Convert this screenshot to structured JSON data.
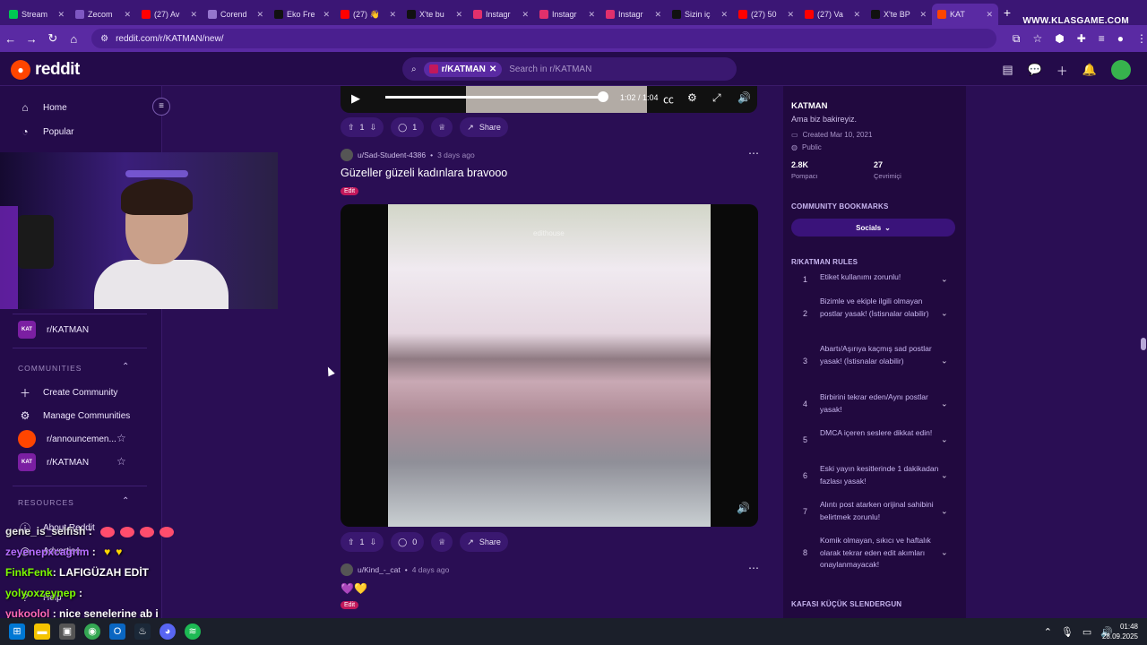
{
  "browser": {
    "tabs": [
      {
        "label": "Stream",
        "color": "#00c853"
      },
      {
        "label": "Zecom",
        "color": "#7e57c2"
      },
      {
        "label": "(27) Av",
        "color": "#ff0000"
      },
      {
        "label": "Corend",
        "color": "#9575cd"
      },
      {
        "label": "Eko Fre",
        "color": "#111111"
      },
      {
        "label": "(27) 👋",
        "color": "#ff0000"
      },
      {
        "label": "X'te bu",
        "color": "#111111"
      },
      {
        "label": "Instagr",
        "color": "#e1306c"
      },
      {
        "label": "Instagr",
        "color": "#e1306c"
      },
      {
        "label": "Instagr",
        "color": "#e1306c"
      },
      {
        "label": "Sizin iç",
        "color": "#111111"
      },
      {
        "label": "(27) 50",
        "color": "#ff0000"
      },
      {
        "label": "(27) Va",
        "color": "#ff0000"
      },
      {
        "label": "X'te BP",
        "color": "#111111"
      },
      {
        "label": "KAT",
        "color": "#ff4500"
      }
    ],
    "url": "reddit.com/r/KATMAN/new/",
    "watermark": "WWW.KLASGAME.COM"
  },
  "header": {
    "logo_text": "reddit",
    "search_chip": "r/KATMAN",
    "search_placeholder": "Search in r/KATMAN"
  },
  "left_nav": {
    "home": "Home",
    "popular": "Popular",
    "sub_katman": "r/KATMAN",
    "communities_label": "COMMUNITIES",
    "create_community": "Create Community",
    "manage_communities": "Manage Communities",
    "announcements": "r/announcemen...",
    "katman": "r/KATMAN",
    "resources_label": "RESOURCES",
    "about": "About Reddit",
    "advertise": "Advertise",
    "help": "Help"
  },
  "chat": [
    {
      "user": "gene_is_selfish",
      "text": ":"
    },
    {
      "user": "zeyenepxcagrim",
      "text": ":"
    },
    {
      "user": "FinkFenk",
      "text": ": LAFIGÜZAH EDİT"
    },
    {
      "user": "yolyoxzeynep",
      "text": ":"
    },
    {
      "user": "yukoolol",
      "text": ": nice senelerine ab i"
    }
  ],
  "feed": {
    "video1": {
      "time": "1:02 / 1:04",
      "progress": 0.97
    },
    "post1_actions": {
      "votes": "1",
      "comments": "1",
      "share": "Share"
    },
    "post2": {
      "author": "u/Sad-Student-4386",
      "time": "3 days ago",
      "title": "Güzeller güzeli kadınlara bravooo",
      "flair": "Edit",
      "watermark": "edithouse",
      "votes": "1",
      "comments": "0",
      "share": "Share"
    },
    "post3": {
      "author": "u/Kind_-_cat",
      "time": "4 days ago",
      "content": "💜💛",
      "flair": "Edit"
    }
  },
  "sidebar": {
    "title": "KATMAN",
    "description": "Ama biz bakireyiz.",
    "created": "Created Mar 10, 2021",
    "visibility": "Public",
    "members": "2.8K",
    "members_label": "Pompacı",
    "online": "27",
    "online_label": "Çevrimiçi",
    "bookmarks_label": "COMMUNITY BOOKMARKS",
    "socials": "Socials",
    "rules_label": "R/KATMAN RULES",
    "rules": [
      {
        "n": "1",
        "text": "Etiket kullanımı zorunlu!"
      },
      {
        "n": "2",
        "text": "Bizimle ve ekiple ilgili olmayan postlar yasak! (İstisnalar olabilir)"
      },
      {
        "n": "3",
        "text": "Abartı/Aşırıya kaçmış sad postlar yasak! (İstisnalar olabilir)"
      },
      {
        "n": "4",
        "text": "Birbirini tekrar eden/Aynı postlar yasak!"
      },
      {
        "n": "5",
        "text": "DMCA içeren seslere dikkat edin!"
      },
      {
        "n": "6",
        "text": "Eski yayın kesitlerinde 1 dakikadan fazlası yasak!"
      },
      {
        "n": "7",
        "text": "Alıntı post atarken orijinal sahibini belirtmek zorunlu!"
      },
      {
        "n": "8",
        "text": "Komik olmayan, sıkıcı ve haftalık olarak tekrar eden edit akımları onaylanmayacak!"
      }
    ],
    "next_section": "KAFASI KÜÇÜK SLENDERGUN"
  },
  "taskbar": {
    "time": "01:48",
    "date": "28.09.2025"
  }
}
